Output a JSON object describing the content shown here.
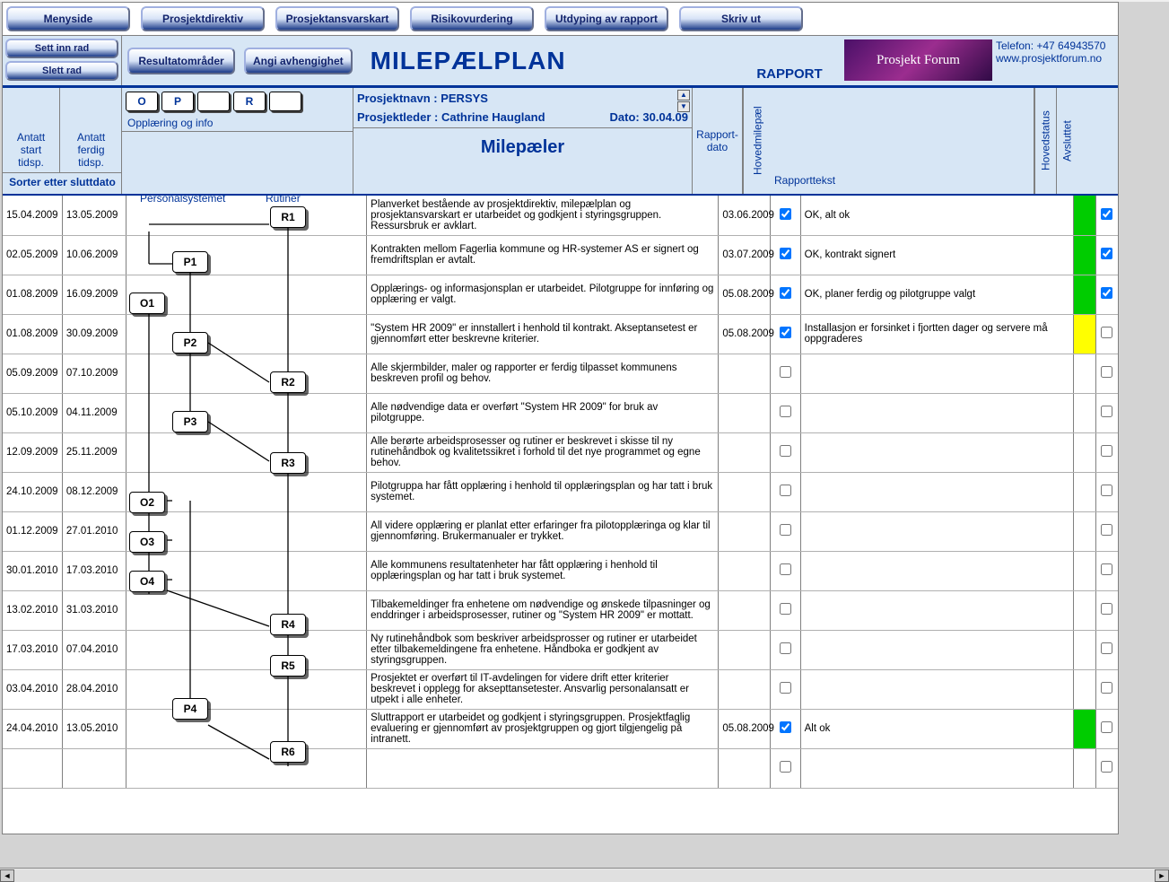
{
  "toolbar": {
    "menyside": "Menyside",
    "prosjektdirektiv": "Prosjektdirektiv",
    "prosjektansvarskart": "Prosjektansvarskart",
    "risikovurdering": "Risikovurdering",
    "utdyping": "Utdyping av rapport",
    "skriv_ut": "Skriv ut"
  },
  "sidebtns": {
    "sett_inn": "Sett inn rad",
    "slett_rad": "Slett rad",
    "resultat": "Resultatområder",
    "angi": "Angi avhengighet"
  },
  "header": {
    "title": "MILEPÆLPLAN",
    "rapport": "RAPPORT",
    "logo": "Prosjekt Forum",
    "telefon": "Telefon: +47 64943570",
    "url": "www.prosjektforum.no"
  },
  "subh": {
    "antatt_start": "Antatt start tidsp.",
    "antatt_ferdig": "Antatt ferdig tidsp.",
    "sorter": "Sorter etter sluttdato",
    "oppl": "Opplæring og info",
    "pers": "Personalsystemet",
    "rut": "Rutiner",
    "codes": {
      "O": "O",
      "P": "P",
      "blank1": "",
      "R": "R",
      "blank2": ""
    },
    "prosjektnavn_lbl": "Prosjektnavn :",
    "prosjektnavn": "PERSYS",
    "prosjektleder_lbl": "Prosjektleder :",
    "prosjektleder": "Cathrine Haugland",
    "dato_lbl": "Dato:",
    "dato": "30.04.09",
    "milepaeler": "Milepæler",
    "rapport_dato": "Rapport-dato",
    "hovedmilepael": "Hovedmilepæl",
    "rapporttekst": "Rapporttekst",
    "hovedstatus": "Hovedstatus",
    "avsluttet": "Avsluttet"
  },
  "rows": [
    {
      "start": "15.04.2009",
      "end": "13.05.2009",
      "desc": "Planverket bestående av prosjektdirektiv, milepælplan og prosjektansvarskart er utarbeidet og godkjent i styringsgruppen. Ressursbruk er avklart.",
      "rdate": "03.06.2009",
      "hm": true,
      "txt": "OK, alt ok",
      "status": "green",
      "av": true
    },
    {
      "start": "02.05.2009",
      "end": "10.06.2009",
      "desc": "Kontrakten mellom Fagerlia kommune og HR-systemer AS er signert og fremdriftsplan er avtalt.",
      "rdate": "03.07.2009",
      "hm": true,
      "txt": "OK, kontrakt signert",
      "status": "green",
      "av": true
    },
    {
      "start": "01.08.2009",
      "end": "16.09.2009",
      "desc": "Opplærings- og informasjonsplan er utarbeidet. Pilotgruppe for innføring og opplæring er valgt.",
      "rdate": "05.08.2009",
      "hm": true,
      "txt": "OK, planer ferdig og pilotgruppe valgt",
      "status": "green",
      "av": true
    },
    {
      "start": "01.08.2009",
      "end": "30.09.2009",
      "desc": "\"System HR 2009\" er innstallert i henhold til kontrakt. Akseptansetest er gjennomført etter beskrevne kriterier.",
      "rdate": "05.08.2009",
      "hm": true,
      "txt": "Installasjon er forsinket i fjortten dager og servere må oppgraderes",
      "status": "yellow",
      "av": false
    },
    {
      "start": "05.09.2009",
      "end": "07.10.2009",
      "desc": "Alle skjermbilder, maler og rapporter er ferdig tilpasset kommunens beskreven profil og behov.",
      "rdate": "",
      "hm": false,
      "txt": "",
      "status": "",
      "av": false
    },
    {
      "start": "05.10.2009",
      "end": "04.11.2009",
      "desc": "Alle nødvendige data er overført \"System HR 2009\" for bruk av pilotgruppe.",
      "rdate": "",
      "hm": false,
      "txt": "",
      "status": "",
      "av": false
    },
    {
      "start": "12.09.2009",
      "end": "25.11.2009",
      "desc": "Alle berørte arbeidsprosesser og rutiner er beskrevet i skisse til ny rutinehåndbok og kvalitetssikret i forhold til det nye programmet og egne behov.",
      "rdate": "",
      "hm": false,
      "txt": "",
      "status": "",
      "av": false
    },
    {
      "start": "24.10.2009",
      "end": "08.12.2009",
      "desc": "Pilotgruppa har fått opplæring i henhold til opplæringsplan og har tatt i bruk systemet.",
      "rdate": "",
      "hm": false,
      "txt": "",
      "status": "",
      "av": false
    },
    {
      "start": "01.12.2009",
      "end": "27.01.2010",
      "desc": "All videre opplæring er planlat etter erfaringer fra pilotopplæringa og klar til gjennomføring. Brukermanualer er trykket.",
      "rdate": "",
      "hm": false,
      "txt": "",
      "status": "",
      "av": false
    },
    {
      "start": "30.01.2010",
      "end": "17.03.2010",
      "desc": "Alle kommunens resultatenheter har fått opplæring i henhold til opplæringsplan og har tatt i bruk systemet.",
      "rdate": "",
      "hm": false,
      "txt": "",
      "status": "",
      "av": false
    },
    {
      "start": "13.02.2010",
      "end": "31.03.2010",
      "desc": "Tilbakemeldinger fra enhetene om nødvendige og ønskede tilpasninger og enddringer i arbeidsprosesser, rutiner og \"System HR 2009\" er mottatt.",
      "rdate": "",
      "hm": false,
      "txt": "",
      "status": "",
      "av": false
    },
    {
      "start": "17.03.2010",
      "end": "07.04.2010",
      "desc": "Ny rutinehåndbok som beskriver arbeidsprosser og rutiner er utarbeidet etter tilbakemeldingene fra enhetene. Håndboka er godkjent av styringsgruppen.",
      "rdate": "",
      "hm": false,
      "txt": "",
      "status": "",
      "av": false
    },
    {
      "start": "03.04.2010",
      "end": "28.04.2010",
      "desc": "Prosjektet er overført til IT-avdelingen for videre drift etter kriterier beskrevet i opplegg for aksepttansetester. Ansvarlig personalansatt er utpekt i alle enheter.",
      "rdate": "",
      "hm": false,
      "txt": "",
      "status": "",
      "av": false
    },
    {
      "start": "24.04.2010",
      "end": "13.05.2010",
      "desc": "Sluttrapport er utarbeidet og godkjent i styringsgruppen. Prosjektfaglig evaluering er gjennomført av prosjektgruppen og gjort tilgjengelig på intranett.",
      "rdate": "05.08.2009",
      "hm": true,
      "txt": "Alt ok",
      "status": "green",
      "av": false
    },
    {
      "start": "",
      "end": "",
      "desc": "",
      "rdate": "",
      "hm": false,
      "txt": "",
      "status": "",
      "av": false
    }
  ],
  "nodes": {
    "R1": "R1",
    "P1": "P1",
    "O1": "O1",
    "P2": "P2",
    "R2": "R2",
    "P3": "P3",
    "R3": "R3",
    "O2": "O2",
    "O3": "O3",
    "O4": "O4",
    "R4": "R4",
    "R5": "R5",
    "P4": "P4",
    "R6": "R6"
  }
}
